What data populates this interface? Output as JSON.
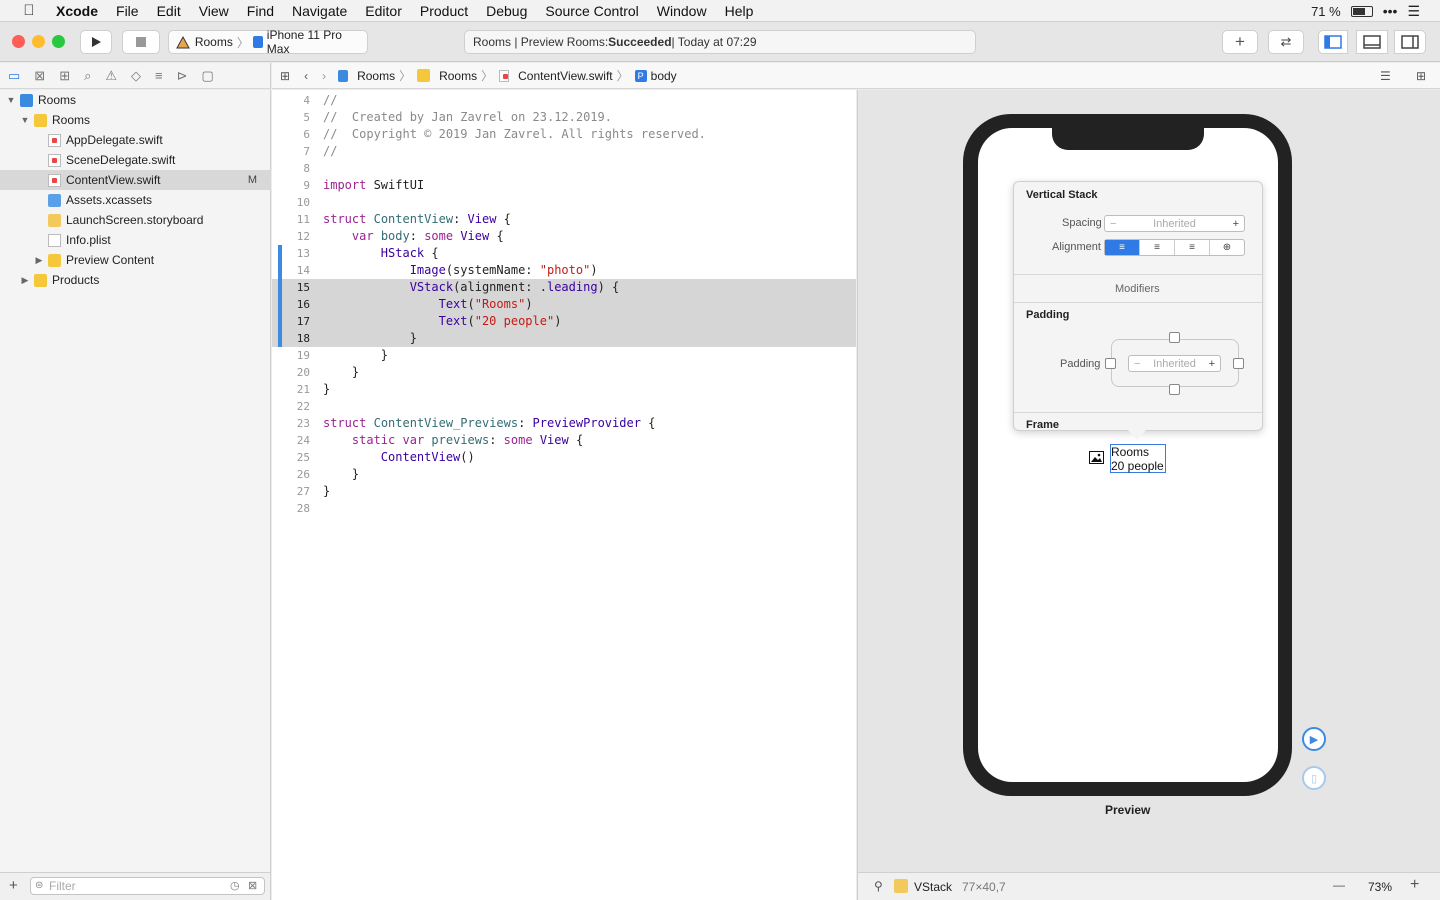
{
  "menubar": {
    "apple": "",
    "items": [
      "Xcode",
      "File",
      "Edit",
      "View",
      "Find",
      "Navigate",
      "Editor",
      "Product",
      "Debug",
      "Source Control",
      "Window",
      "Help"
    ],
    "battery": "71 %",
    "battery_level": 0.71
  },
  "toolbar": {
    "scheme": "Rooms",
    "device": "iPhone 11 Pro Max",
    "activity_prefix": "Rooms | Preview Rooms: ",
    "activity_status": "Succeeded",
    "activity_time": " | Today at 07:29",
    "add": "+"
  },
  "jumpbar": {
    "items": [
      "Rooms",
      "Rooms",
      "ContentView.swift",
      "body"
    ]
  },
  "navigator": {
    "items": [
      {
        "label": "Rooms",
        "icon": "project-icon",
        "level": 0,
        "disclosure": "▼"
      },
      {
        "label": "Rooms",
        "icon": "folder-icon",
        "level": 1,
        "disclosure": "▼"
      },
      {
        "label": "AppDelegate.swift",
        "icon": "swift-file-icon",
        "level": 2
      },
      {
        "label": "SceneDelegate.swift",
        "icon": "swift-file-icon",
        "level": 2
      },
      {
        "label": "ContentView.swift",
        "icon": "swift-file-icon",
        "level": 2,
        "selected": true,
        "badge": "M"
      },
      {
        "label": "Assets.xcassets",
        "icon": "assets-icon",
        "level": 2
      },
      {
        "label": "LaunchScreen.storyboard",
        "icon": "storyboard-icon",
        "level": 2
      },
      {
        "label": "Info.plist",
        "icon": "plist-icon",
        "level": 2
      },
      {
        "label": "Preview Content",
        "icon": "folder-icon",
        "level": 2,
        "disclosure": "▶"
      },
      {
        "label": "Products",
        "icon": "folder-icon",
        "level": 1,
        "disclosure": "▶"
      }
    ],
    "filter_placeholder": "Filter"
  },
  "editor": {
    "lines": [
      {
        "n": "4",
        "tokens": [
          [
            "cm",
            "//"
          ]
        ]
      },
      {
        "n": "5",
        "tokens": [
          [
            "cm",
            "//  Created by Jan Zavrel on 23.12.2019."
          ]
        ]
      },
      {
        "n": "6",
        "tokens": [
          [
            "cm",
            "//  Copyright © 2019 Jan Zavrel. All rights reserved."
          ]
        ]
      },
      {
        "n": "7",
        "tokens": [
          [
            "cm",
            "//"
          ]
        ]
      },
      {
        "n": "8",
        "tokens": []
      },
      {
        "n": "9",
        "tokens": [
          [
            "kw",
            "import"
          ],
          [
            "pl",
            " SwiftUI"
          ]
        ]
      },
      {
        "n": "10",
        "tokens": []
      },
      {
        "n": "11",
        "tokens": [
          [
            "kw",
            "struct"
          ],
          [
            "pl",
            " "
          ],
          [
            "fn",
            "ContentView"
          ],
          [
            "pl",
            ": "
          ],
          [
            "ty",
            "View"
          ],
          [
            "pl",
            " {"
          ]
        ]
      },
      {
        "n": "12",
        "tokens": [
          [
            "pl",
            "    "
          ],
          [
            "kw",
            "var"
          ],
          [
            "pl",
            " "
          ],
          [
            "fn",
            "body"
          ],
          [
            "pl",
            ": "
          ],
          [
            "kw",
            "some"
          ],
          [
            "pl",
            " "
          ],
          [
            "ty",
            "View"
          ],
          [
            "pl",
            " {"
          ]
        ]
      },
      {
        "n": "13",
        "tokens": [
          [
            "pl",
            "        "
          ],
          [
            "ty",
            "HStack"
          ],
          [
            "pl",
            " {"
          ]
        ]
      },
      {
        "n": "14",
        "tokens": [
          [
            "pl",
            "            "
          ],
          [
            "ty",
            "Image"
          ],
          [
            "pl",
            "(systemName: "
          ],
          [
            "st",
            "\"photo\""
          ],
          [
            "pl",
            ")"
          ]
        ]
      },
      {
        "n": "15",
        "tokens": [
          [
            "pl",
            "            "
          ],
          [
            "ty",
            "VStack"
          ],
          [
            "pl",
            "(alignment: ."
          ],
          [
            "ty",
            "leading"
          ],
          [
            "pl",
            ") {"
          ]
        ],
        "hl": true,
        "cur": true
      },
      {
        "n": "16",
        "tokens": [
          [
            "pl",
            "                "
          ],
          [
            "ty",
            "Text"
          ],
          [
            "pl",
            "("
          ],
          [
            "st",
            "\"Rooms\""
          ],
          [
            "pl",
            ")"
          ]
        ],
        "hl": true,
        "cur": true
      },
      {
        "n": "17",
        "tokens": [
          [
            "pl",
            "                "
          ],
          [
            "ty",
            "Text"
          ],
          [
            "pl",
            "("
          ],
          [
            "st",
            "\"20 people\""
          ],
          [
            "pl",
            ")"
          ]
        ],
        "hl": true,
        "cur": true
      },
      {
        "n": "18",
        "tokens": [
          [
            "pl",
            "            }"
          ]
        ],
        "hl": true,
        "cur": true
      },
      {
        "n": "19",
        "tokens": [
          [
            "pl",
            "        }"
          ]
        ]
      },
      {
        "n": "20",
        "tokens": [
          [
            "pl",
            "    }"
          ]
        ]
      },
      {
        "n": "21",
        "tokens": [
          [
            "pl",
            "}"
          ]
        ]
      },
      {
        "n": "22",
        "tokens": []
      },
      {
        "n": "23",
        "tokens": [
          [
            "kw",
            "struct"
          ],
          [
            "pl",
            " "
          ],
          [
            "fn",
            "ContentView_Previews"
          ],
          [
            "pl",
            ": "
          ],
          [
            "ty",
            "PreviewProvider"
          ],
          [
            "pl",
            " {"
          ]
        ]
      },
      {
        "n": "24",
        "tokens": [
          [
            "pl",
            "    "
          ],
          [
            "kw",
            "static"
          ],
          [
            "pl",
            " "
          ],
          [
            "kw",
            "var"
          ],
          [
            "pl",
            " "
          ],
          [
            "fn",
            "previews"
          ],
          [
            "pl",
            ": "
          ],
          [
            "kw",
            "some"
          ],
          [
            "pl",
            " "
          ],
          [
            "ty",
            "View"
          ],
          [
            "pl",
            " {"
          ]
        ]
      },
      {
        "n": "25",
        "tokens": [
          [
            "pl",
            "        "
          ],
          [
            "ty",
            "ContentView"
          ],
          [
            "pl",
            "()"
          ]
        ]
      },
      {
        "n": "26",
        "tokens": [
          [
            "pl",
            "    }"
          ]
        ]
      },
      {
        "n": "27",
        "tokens": [
          [
            "pl",
            "}"
          ]
        ]
      },
      {
        "n": "28",
        "tokens": []
      }
    ]
  },
  "inspector": {
    "title": "Vertical Stack",
    "spacing_label": "Spacing",
    "spacing_value": "Inherited",
    "alignment_label": "Alignment",
    "modifiers": "Modifiers",
    "padding_title": "Padding",
    "padding_label": "Padding",
    "padding_value": "Inherited",
    "frame_title": "Frame",
    "minus": "−",
    "plus": "+"
  },
  "preview": {
    "text1": "Rooms",
    "text2": "20 people",
    "caption": "Preview"
  },
  "bottombar": {
    "element": "VStack",
    "size": "77×40,7",
    "zoom": "73%",
    "minus": "—",
    "plus": "+"
  },
  "colors": {
    "accent": "#2f7ae5",
    "selection": "#d6d6d6"
  }
}
